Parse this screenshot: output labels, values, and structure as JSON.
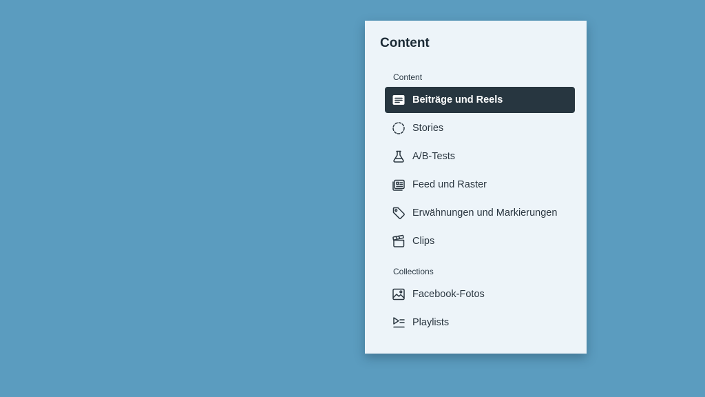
{
  "panel": {
    "title": "Content",
    "sections": [
      {
        "label": "Content",
        "items": [
          {
            "label": "Beiträge und Reels",
            "icon": "posts-icon",
            "active": true
          },
          {
            "label": "Stories",
            "icon": "stories-icon",
            "active": false
          },
          {
            "label": "A/B-Tests",
            "icon": "flask-icon",
            "active": false
          },
          {
            "label": "Feed und Raster",
            "icon": "feed-grid-icon",
            "active": false
          },
          {
            "label": "Erwähnungen und Markierungen",
            "icon": "tag-icon",
            "active": false
          },
          {
            "label": "Clips",
            "icon": "clapperboard-icon",
            "active": false
          }
        ]
      },
      {
        "label": "Collections",
        "items": [
          {
            "label": "Facebook-Fotos",
            "icon": "photo-icon",
            "active": false
          },
          {
            "label": "Playlists",
            "icon": "playlist-icon",
            "active": false
          }
        ]
      }
    ]
  },
  "colors": {
    "background": "#5b9cbf",
    "panel": "#edf4f9",
    "active_item": "#273640",
    "text": "#2a3640"
  }
}
